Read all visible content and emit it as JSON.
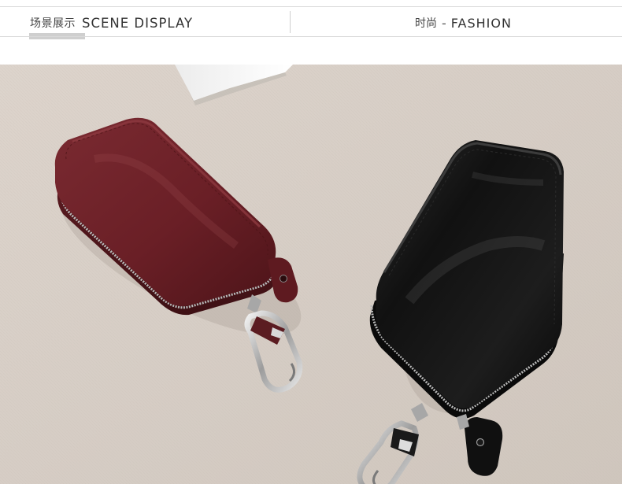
{
  "header": {
    "left_cn": "场景展示",
    "left_en": "SCENE DISPLAY",
    "right_cn": "时尚",
    "right_sep": "-",
    "right_en": "FASHION"
  },
  "photo": {
    "subject": "two leather key wallets with snap hooks",
    "items": [
      {
        "name": "burgundy-key-wallet",
        "color": "#6b1f25"
      },
      {
        "name": "black-key-wallet",
        "color": "#141414"
      }
    ],
    "background_color": "#d8d0c8"
  }
}
